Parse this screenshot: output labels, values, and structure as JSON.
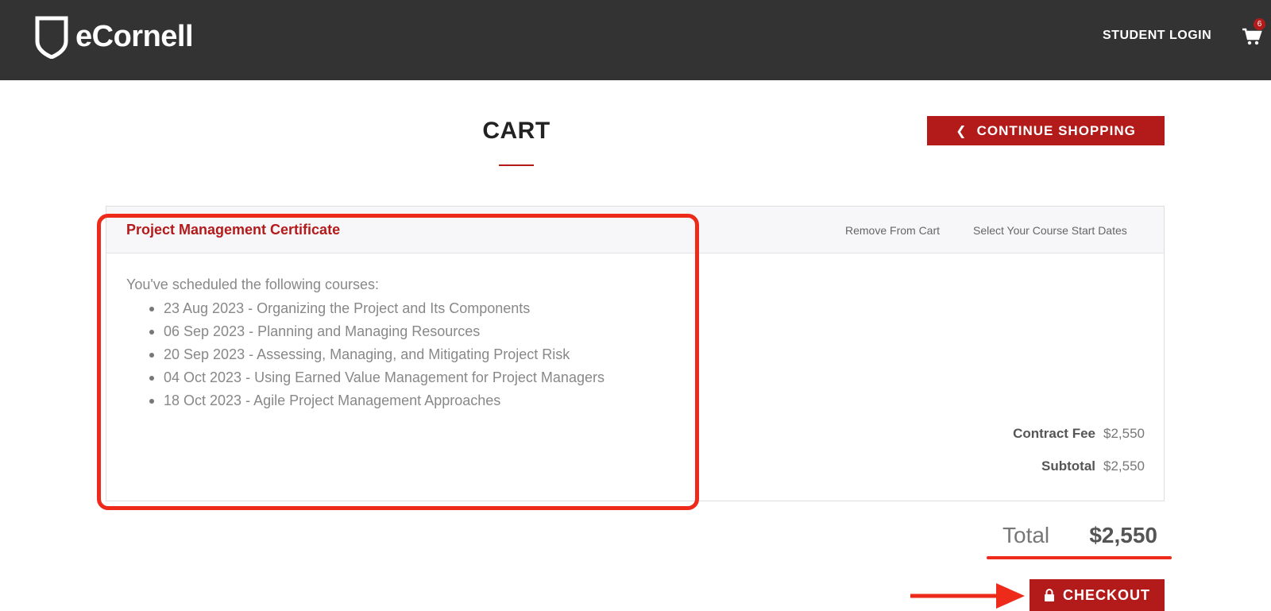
{
  "header": {
    "brand": "eCornell",
    "student_login": "STUDENT LOGIN",
    "cart_count": "6",
    "logo_icon": "shield-icon",
    "cart_icon": "shopping-cart-icon"
  },
  "page": {
    "title": "CART",
    "continue_shopping": "CONTINUE SHOPPING"
  },
  "cart_item": {
    "title": "Project Management Certificate",
    "remove": "Remove From Cart",
    "select_dates": "Select Your Course Start Dates",
    "scheduled_label": "You've scheduled the following courses:",
    "courses": [
      "23 Aug 2023 - Organizing the Project and Its Components",
      "06 Sep 2023 - Planning and Managing Resources",
      "20 Sep 2023 - Assessing, Managing, and Mitigating Project Risk",
      "04 Oct 2023 - Using Earned Value Management for Project Managers",
      "18 Oct 2023 - Agile Project Management Approaches"
    ],
    "contract_fee_label": "Contract Fee",
    "contract_fee_value": "$2,550",
    "subtotal_label": "Subtotal",
    "subtotal_value": "$2,550"
  },
  "summary": {
    "total_label": "Total",
    "total_value": "$2,550",
    "checkout": "CHECKOUT"
  },
  "colors": {
    "brand_red": "#b31b1b",
    "annotation_red": "#ee2a1a",
    "header_bg": "#333333"
  }
}
